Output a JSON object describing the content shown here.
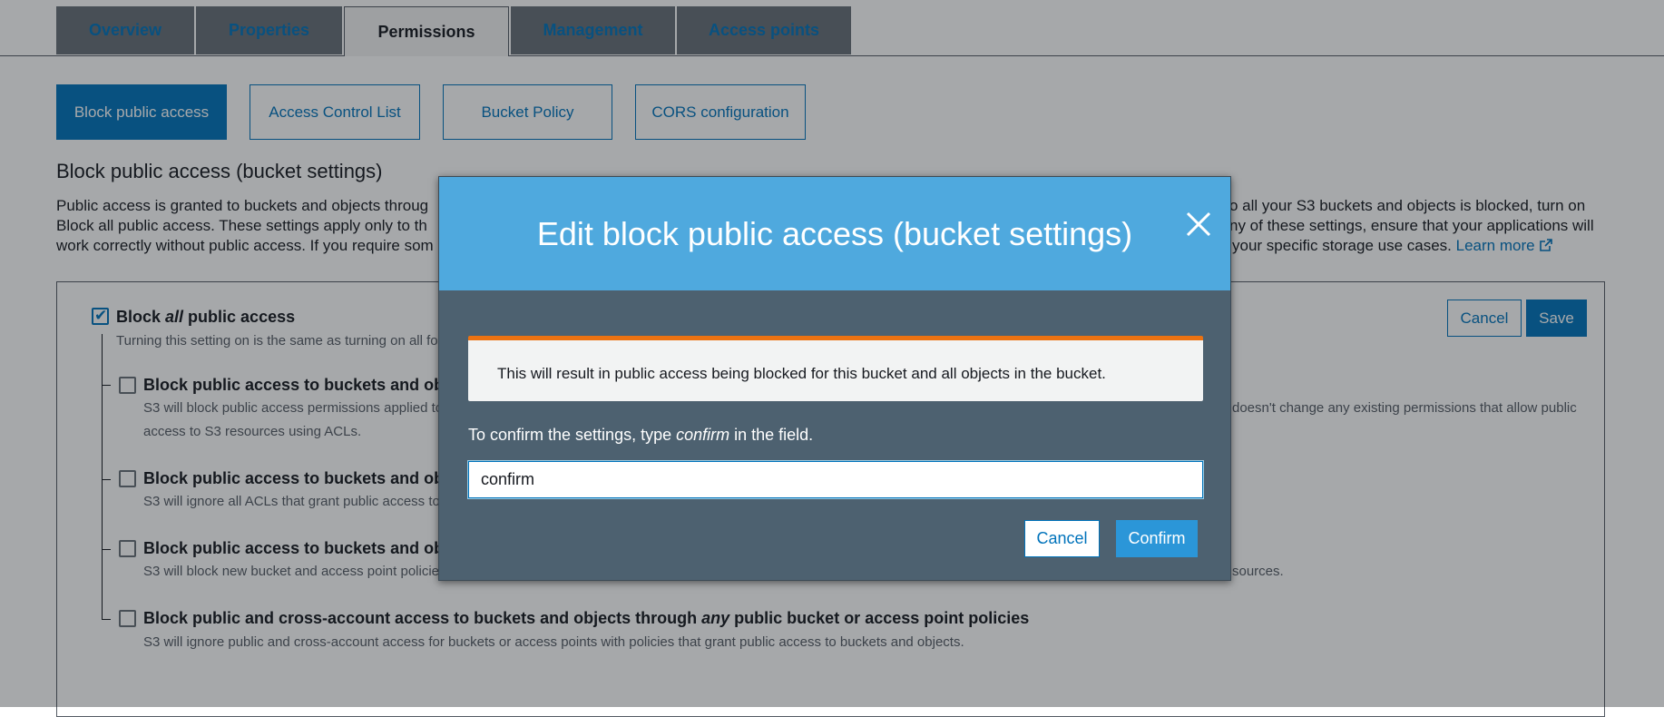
{
  "tabs": [
    "Overview",
    "Properties",
    "Permissions",
    "Management",
    "Access points"
  ],
  "active_tab": "Permissions",
  "sub_tabs": [
    "Block public access",
    "Access Control List",
    "Bucket Policy",
    "CORS configuration"
  ],
  "section": {
    "title": "Block public access (bucket settings)",
    "desc_parts": [
      "Public access is granted to buckets and objects throug",
      "Block all public access. These settings apply only to th",
      "work correctly without public access. If you require som",
      "o all your S3 buckets and objects is blocked, turn on",
      "ny of these settings, ensure that your applications will",
      "your specific storage use cases."
    ],
    "learn_more": "Learn more"
  },
  "panel": {
    "cancel_label": "Cancel",
    "save_label": "Save",
    "master": {
      "title_pre": "Block ",
      "title_em": "all",
      "title_post": " public access",
      "desc": "Turning this setting on is the same as turning on all fo",
      "checked": true
    },
    "options": [
      {
        "title": "Block public access to buckets and obj",
        "desc1": "S3 will block public access permissions applied to",
        "desc1b": "doesn't change any existing permissions that allow public",
        "desc2": "access to S3 resources using ACLs."
      },
      {
        "title": "Block public access to buckets and obj",
        "desc1": "S3 will ignore all ACLs that grant public access to"
      },
      {
        "title": "Block public access to buckets and obj",
        "desc1": "S3 will block new bucket and access point policie",
        "desc1b": "sources."
      },
      {
        "title_pre": "Block public and cross-account access to buckets and objects through ",
        "title_em": "any",
        "title_post": " public bucket or access point policies",
        "desc1": "S3 will ignore public and cross-account access for buckets or access points with policies that grant public access to buckets and objects."
      }
    ]
  },
  "modal": {
    "title": "Edit block public access (bucket settings)",
    "alert": "This will result in public access being blocked for this bucket and all objects in the bucket.",
    "label_pre": "To confirm the settings, type ",
    "label_em": "confirm",
    "label_post": " in the field.",
    "input_value": "confirm",
    "cancel_label": "Cancel",
    "confirm_label": "Confirm"
  },
  "colors": {
    "accent": "#0073bb",
    "modal_header": "#4fa9de",
    "warning": "#ec7211"
  },
  "icons": {
    "close": "close-icon",
    "external_link": "external-link-icon",
    "check": "check-icon"
  }
}
